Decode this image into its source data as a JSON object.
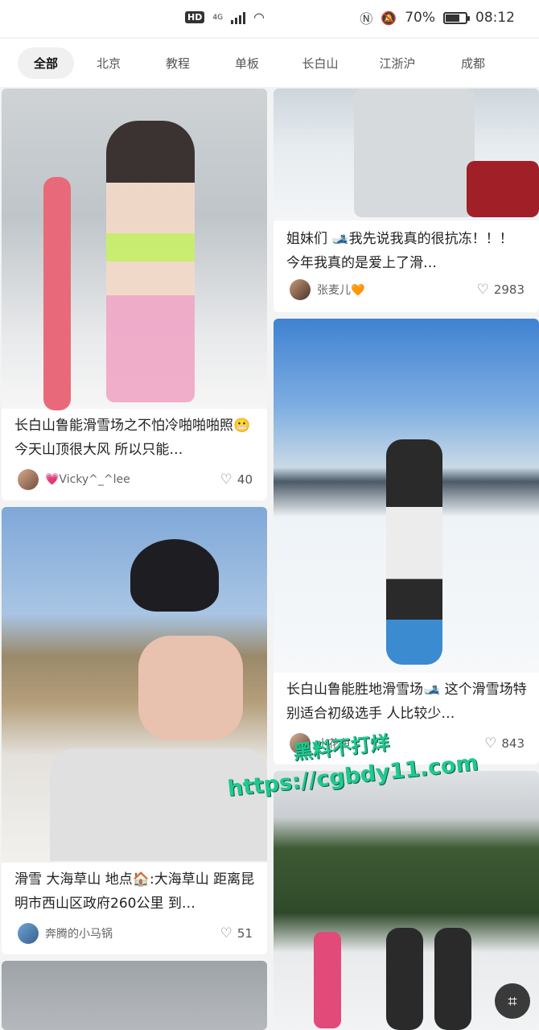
{
  "status_bar": {
    "hd": "HD",
    "network": "4G",
    "battery_text": "70%",
    "battery_level": 0.7,
    "time": "08:12"
  },
  "tabs": [
    {
      "label": "全部",
      "active": true
    },
    {
      "label": "北京"
    },
    {
      "label": "教程"
    },
    {
      "label": "单板"
    },
    {
      "label": "长白山"
    },
    {
      "label": "江浙沪"
    },
    {
      "label": "成都"
    }
  ],
  "feed": {
    "left": [
      {
        "title": "长白山鲁能滑雪场之不怕冷啪啪啪照😬 今天山顶很大风 所以只能…",
        "author": "💗Vicky^_^lee",
        "likes": "40",
        "photo_colors": [
          "#cfd3d6",
          "#f0a6c6"
        ]
      },
      {
        "title": "滑雪 大海草山 地点🏠:大海草山 距离昆明市西山区政府260公里 到…",
        "author": "奔腾的小马锅",
        "likes": "51",
        "photo_colors": [
          "#7fa8d8",
          "#d8d4cc"
        ]
      }
    ],
    "right": [
      {
        "title": "姐妹们 🎿我先说我真的很抗冻！！！ 今年我真的是爱上了滑…",
        "author": "张麦儿🧡",
        "likes": "2983",
        "photo_colors": [
          "#e7ecf0",
          "#b8c4cc"
        ]
      },
      {
        "title": "长白山鲁能胜地滑雪场🎿 这个滑雪场特别适合初级选手 人比较少…",
        "author": "小花鱼",
        "likes": "843",
        "photo_colors": [
          "#4b8ed6",
          "#eef3f7"
        ]
      }
    ]
  },
  "watermark": {
    "line1": "黑料不打烊",
    "line2": "https://cgbdy11.com"
  },
  "icons": {
    "heart": "heart-icon",
    "scan": "scan-icon",
    "wifi": "wifi-icon",
    "nfc": "nfc-icon",
    "mute": "mute-icon"
  }
}
